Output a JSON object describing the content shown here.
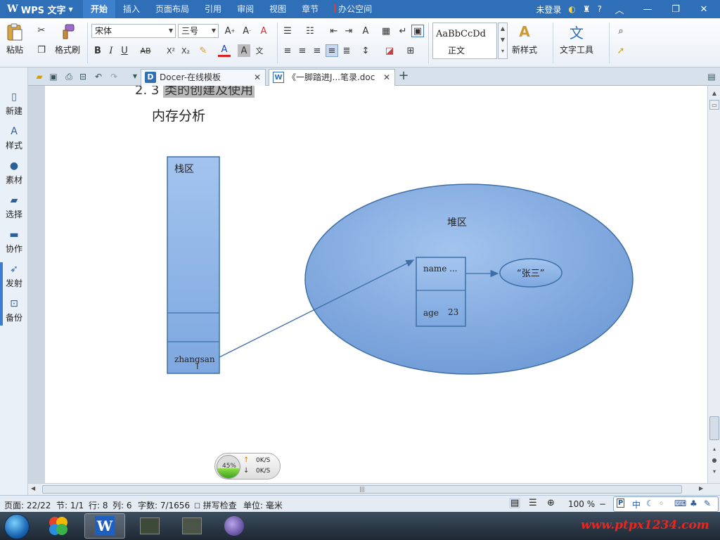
{
  "titlebar": {
    "app_name": "WPS 文字",
    "tabs": [
      "开始",
      "插入",
      "页面布局",
      "引用",
      "审阅",
      "视图",
      "章节",
      "办公空间"
    ],
    "login": "未登录",
    "help": "?"
  },
  "ribbon": {
    "paste": "粘贴",
    "format_painter": "格式刷",
    "font_name": "宋体",
    "font_size": "三号",
    "style_sample": "AaBbCcDd",
    "style_name": "正文",
    "new_style": "新样式",
    "text_tools": "文字工具"
  },
  "left_panel": [
    "新建",
    "样式",
    "素材",
    "选择",
    "协作",
    "发射",
    "备份"
  ],
  "doc_tabs": [
    {
      "title": "Docer-在线模板",
      "icon": "D"
    },
    {
      "title": "《一脚踏进J...笔录.doc",
      "icon": "W"
    }
  ],
  "document": {
    "heading_prefix": "2. 3",
    "heading_highlight": "类的创建及使用",
    "subtitle": "内存分析",
    "stack_label": "栈区",
    "stack_var": "zhangsan",
    "heap_label": "堆区",
    "object_field_name": "name ...",
    "object_field_age_key": "age",
    "object_field_age_value": "23",
    "string_value": "“张三”"
  },
  "net_widget": {
    "percent_label": "45%",
    "percent_value": 45,
    "up_rate": "0K/S",
    "down_rate": "0K/S"
  },
  "statusbar": {
    "page": "页面: 22/22",
    "section": "节: 1/1",
    "line": "行: 8",
    "column": "列: 6",
    "word_count": "字数: 7/1656",
    "spell_check": "拼写检查",
    "unit": "单位: 毫米",
    "zoom": "100 %"
  },
  "ime": {
    "mode": "中"
  },
  "taskbar": {
    "watermark": "www.ptpx1234.com"
  }
}
